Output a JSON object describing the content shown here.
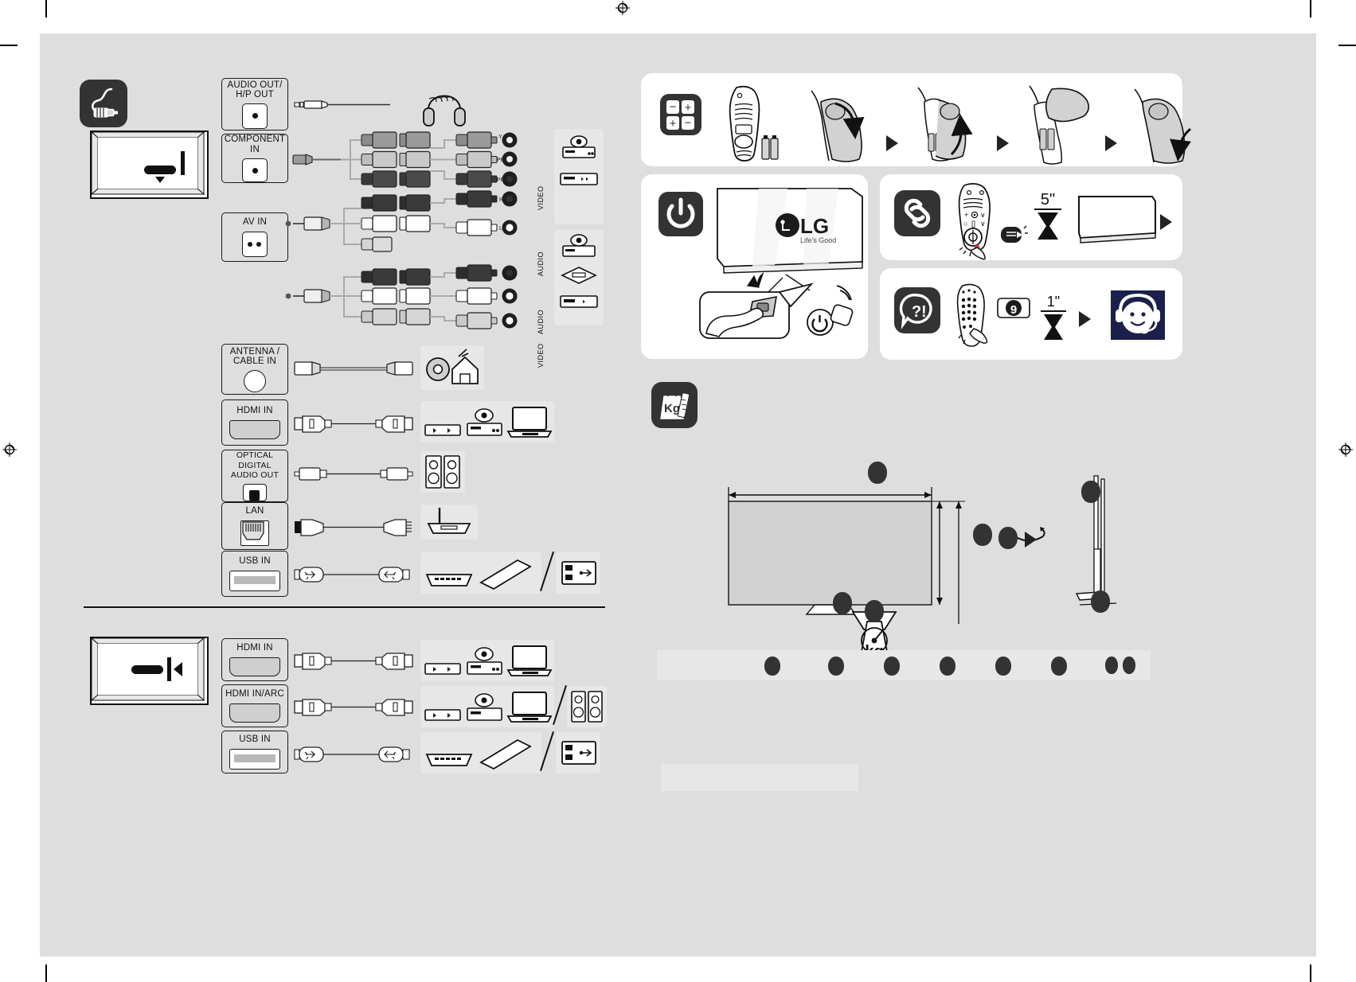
{
  "document": {
    "type": "tv-quick-setup-guide",
    "brand": "LG",
    "brand_tagline": "Life's Good",
    "page_background": "#dedede",
    "sheet_background": "#dedede",
    "accent_dark": "#333333",
    "support_badge_color": "#1b1f4b",
    "pairing_dot_color": "#e0304a"
  },
  "connections_panel": {
    "icon": "cable-plug-icon",
    "rear_tv_thumb": "tv-rear-ports-thumbnail",
    "side_tv_thumb": "tv-side-ports-thumbnail",
    "rear_ports": [
      {
        "label": "AUDIO OUT/\nH/P OUT",
        "label_line1": "AUDIO OUT/",
        "label_line2": "H/P OUT",
        "jack": "audio-jack-icon",
        "cable": "3.5mm-stereo-cable",
        "devices": [
          "headphones"
        ]
      },
      {
        "label": "COMPONENT IN",
        "label_line1": "COMPONENT IN",
        "label_line2": "",
        "jack": "component-jack-icon",
        "cable": "component-rca-cable",
        "devices": [
          "set-top-box",
          "dvd-player"
        ]
      },
      {
        "label": "AV IN",
        "label_line1": "AV IN",
        "label_line2": "",
        "jack": "av-jack-icon",
        "cable": "composite-rca-cable",
        "devices": [
          "set-top-box",
          "game-console",
          "vcr"
        ]
      },
      {
        "label": "ANTENNA /\nCABLE IN",
        "label_line1": "ANTENNA /",
        "label_line2": "CABLE IN",
        "jack": "coax-jack-icon",
        "cable": "coaxial-cable",
        "devices": [
          "antenna-wall-outlet"
        ]
      },
      {
        "label": "HDMI IN",
        "label_line1": "HDMI IN",
        "label_line2": "",
        "jack": "hdmi-jack-icon",
        "cable": "hdmi-cable",
        "devices": [
          "set-top-box",
          "dvd-player",
          "laptop"
        ]
      },
      {
        "label": "OPTICAL DIGITAL\nAUDIO OUT",
        "label_line1": "OPTICAL DIGITAL",
        "label_line2": "AUDIO OUT",
        "jack": "optical-jack-icon",
        "cable": "optical-toslink-cable",
        "devices": [
          "speakers"
        ]
      },
      {
        "label": "LAN",
        "label_line1": "LAN",
        "label_line2": "",
        "jack": "lan-jack-icon",
        "cable": "ethernet-cable",
        "devices": [
          "router"
        ]
      },
      {
        "label": "USB IN",
        "label_line1": "USB IN",
        "label_line2": "",
        "jack": "usb-jack-icon",
        "cable": "usb-cable",
        "devices": [
          "external-hdd",
          "usb-flash-drive",
          "usb-hub"
        ]
      }
    ],
    "side_ports": [
      {
        "label": "HDMI IN",
        "label_line1": "HDMI IN",
        "jack": "hdmi-jack-icon",
        "cable": "hdmi-cable",
        "devices": [
          "set-top-box",
          "dvd-player",
          "laptop"
        ]
      },
      {
        "label": "HDMI IN/ARC",
        "label_line1": "HDMI IN/ARC",
        "jack": "hdmi-jack-icon",
        "cable": "hdmi-cable",
        "devices": [
          "set-top-box",
          "dvd-player",
          "laptop",
          "speakers"
        ]
      },
      {
        "label": "USB IN",
        "label_line1": "USB IN",
        "jack": "usb-jack-icon",
        "cable": "usb-cable",
        "devices": [
          "external-hdd",
          "usb-flash-drive",
          "usb-hub"
        ]
      }
    ],
    "component_jack_labels": [
      "VIDEO",
      "AUDIO"
    ],
    "av_jack_labels": [
      "AUDIO",
      "VIDEO"
    ]
  },
  "battery_card": {
    "icon": "battery-polarity-icon",
    "steps": [
      "magic-remote-with-batteries",
      "remote-back-cover-slide-open",
      "remote-cover-lifted",
      "insert-batteries",
      "remote-cover-closed"
    ],
    "arrow": "step-arrow"
  },
  "power_card": {
    "icon": "power-icon",
    "brand": "LG",
    "brand_tagline": "Life's Good",
    "illustration": "tv-front-with-joystick-button",
    "elements": [
      "hand-pressing-joystick",
      "remote-power-button"
    ]
  },
  "pairing_card": {
    "icon": "link-icon",
    "duration_label": "5\"",
    "timer_icon": "hourglass-icon",
    "steps": [
      "press-wheel-button-on-remote",
      "hold-5-seconds",
      "tv-screen",
      "pairing-confirmed"
    ],
    "arrow": "step-arrow"
  },
  "help_card": {
    "icon": "question-exclamation-icon",
    "button_number": "9",
    "duration_label": "1\"",
    "timer_icon": "hourglass-icon",
    "support_avatar": "headset-support-agent-icon",
    "arrow": "step-arrow"
  },
  "specs_panel": {
    "icon": "weight-kg-tag-icon",
    "scale_unit": "kg",
    "scale_icon": "weighing-scale-icon",
    "rotate_icon": "rotate-arrow-icon",
    "arrow": "step-arrow",
    "front_view": "tv-front-dimensions-diagram",
    "side_view": "tv-side-profile-diagram",
    "dimension_markers": [
      {
        "name": "width",
        "value": ""
      },
      {
        "name": "height-panel",
        "value": ""
      },
      {
        "name": "height-with-stand",
        "value": ""
      },
      {
        "name": "stand-width",
        "value": ""
      },
      {
        "name": "weight",
        "value": ""
      },
      {
        "name": "depth-top",
        "value": ""
      },
      {
        "name": "depth-stand",
        "value": ""
      }
    ],
    "legend_markers": [
      "",
      "",
      "",
      "",
      "",
      "",
      "",
      ""
    ],
    "footnote_block": ""
  },
  "print_marks": {
    "registration_top": "registration-mark",
    "registration_bottom": "registration-mark",
    "registration_left": "registration-mark",
    "registration_right": "registration-mark"
  }
}
